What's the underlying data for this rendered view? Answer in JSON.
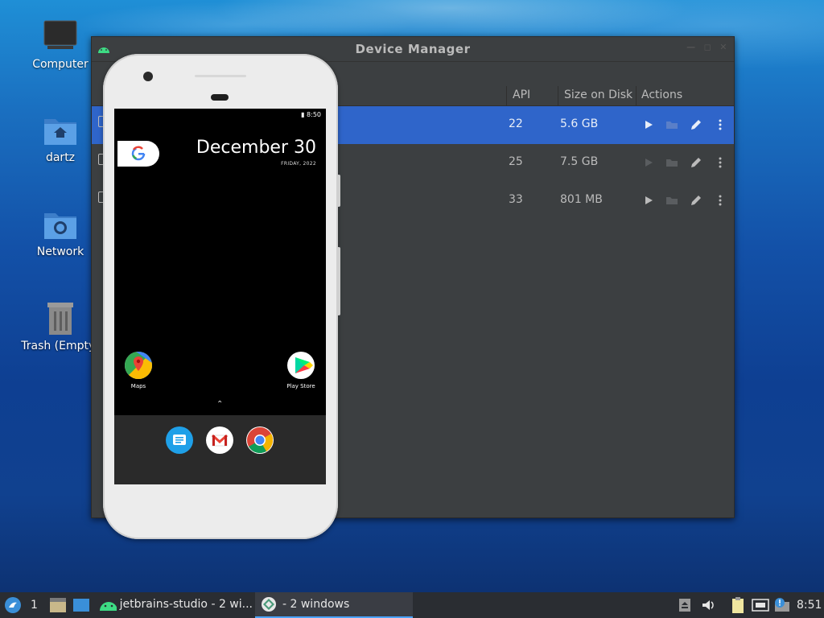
{
  "desktop": {
    "icons": [
      {
        "label": "Computer"
      },
      {
        "label": "dartz"
      },
      {
        "label": "Network"
      },
      {
        "label": "Trash (Empty)"
      }
    ]
  },
  "window": {
    "title": "Device Manager",
    "columns": {
      "api": "API",
      "size": "Size on Disk",
      "actions": "Actions"
    },
    "rows": [
      {
        "api": "22",
        "size": "5.6 GB",
        "selected": true
      },
      {
        "api": "25",
        "size": "7.5 GB",
        "selected": false
      },
      {
        "api": "33",
        "size": "801 MB",
        "selected": false
      }
    ]
  },
  "phone": {
    "time": "8:50",
    "date": "December 30",
    "subdate": "FRIDAY, 2022",
    "apps": [
      {
        "label": "Maps"
      },
      {
        "label": "Play Store"
      }
    ],
    "dock": [
      "messages-icon",
      "gmail-icon",
      "chrome-icon"
    ]
  },
  "taskbar": {
    "workspace": "1",
    "tasks": [
      {
        "label": "jetbrains-studio - 2 wi..."
      },
      {
        "label": "- 2 windows"
      }
    ],
    "clock": "8:51"
  },
  "colors": {
    "selection": "#2f65ca",
    "window_bg": "#3c3f41",
    "accent": "#4aa3ff"
  }
}
